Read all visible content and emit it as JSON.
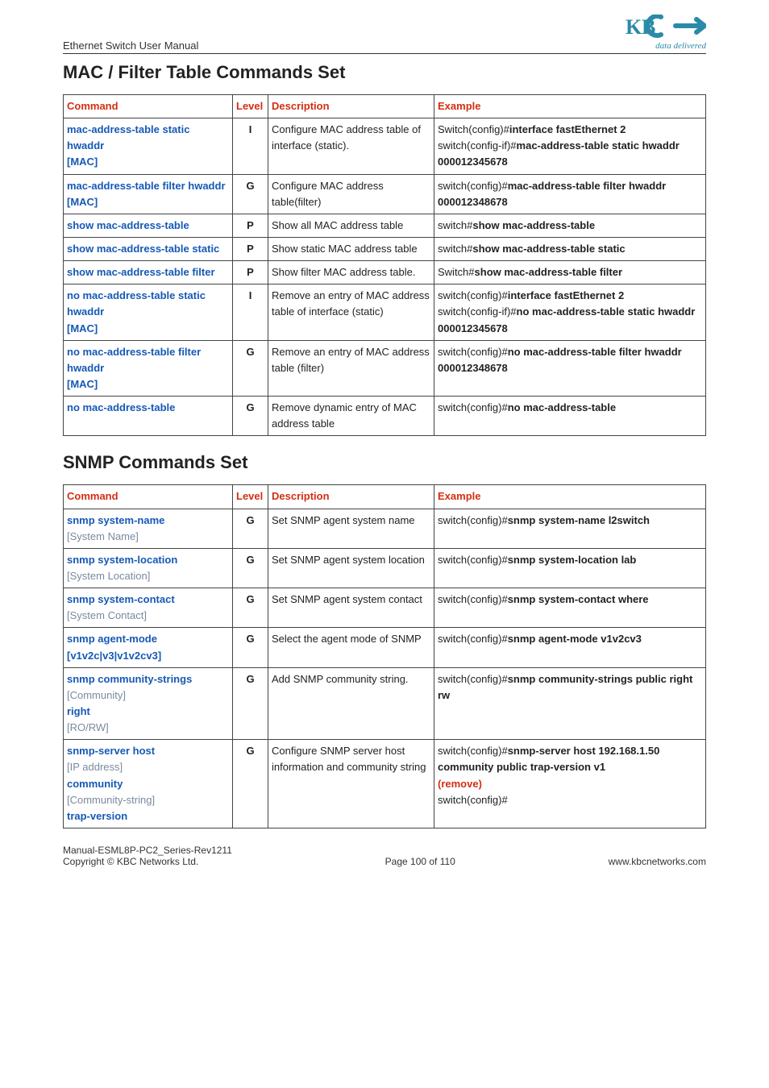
{
  "header": {
    "title": "Ethernet Switch User Manual",
    "logo_tagline": "data delivered"
  },
  "section1": {
    "title": "MAC / Filter Table Commands Set",
    "columns": {
      "cmd": "Command",
      "level": "Level",
      "desc": "Description",
      "example": "Example"
    },
    "rows": [
      {
        "cmd": {
          "kw": "mac-address-table static hwaddr",
          "arg": "[MAC]"
        },
        "level": "I",
        "desc": "Configure MAC address table of interface (static).",
        "ex": [
          {
            "type": "line",
            "pre": "Switch(config)#",
            "bold": "interface fastEthernet 2"
          },
          {
            "type": "line",
            "pre": "switch(config-if)#",
            "bold": "mac-address-table static hwaddr 000012345678"
          }
        ]
      },
      {
        "cmd": {
          "kw": "mac-address-table filter hwaddr",
          "arg": "[MAC]"
        },
        "level": "G",
        "desc": "Configure MAC address table(filter)",
        "ex": [
          {
            "type": "line",
            "pre": "switch(config)#",
            "bold": "mac-address-table filter hwaddr 000012348678"
          }
        ]
      },
      {
        "cmd": {
          "kw": "show mac-address-table"
        },
        "level": "P",
        "desc": "Show all MAC address table",
        "ex": [
          {
            "type": "line",
            "pre": "switch#",
            "bold": "show mac-address-table"
          }
        ]
      },
      {
        "cmd": {
          "kw": "show mac-address-table static"
        },
        "level": "P",
        "desc": "Show static MAC address table",
        "ex": [
          {
            "type": "line",
            "pre": "switch#",
            "bold": "show mac-address-table static"
          }
        ]
      },
      {
        "cmd": {
          "kw": "show mac-address-table filter"
        },
        "level": "P",
        "desc": "Show filter MAC address table.",
        "ex": [
          {
            "type": "line",
            "pre": "Switch#",
            "bold": "show mac-address-table filter"
          }
        ]
      },
      {
        "cmd": {
          "kw": "no mac-address-table static hwaddr",
          "arg": "[MAC]"
        },
        "level": "I",
        "desc": "Remove an entry of MAC address table of interface (static)",
        "ex": [
          {
            "type": "line",
            "pre": "switch(config)#",
            "bold": "interface fastEthernet 2"
          },
          {
            "type": "line",
            "pre": "switch(config-if)#",
            "bold": "no mac-address-table static hwaddr 000012345678"
          }
        ]
      },
      {
        "cmd": {
          "kw": "no mac-address-table filter hwaddr",
          "arg": "[MAC]"
        },
        "level": "G",
        "desc": "Remove an entry of MAC address table (filter)",
        "ex": [
          {
            "type": "line",
            "pre": "switch(config)#",
            "bold": "no mac-address-table filter hwaddr 000012348678"
          }
        ]
      },
      {
        "cmd": {
          "kw": "no mac-address-table"
        },
        "level": "G",
        "desc": "Remove dynamic entry of MAC address table",
        "ex": [
          {
            "type": "line",
            "pre": "switch(config)#",
            "bold": "no mac-address-table"
          }
        ]
      }
    ]
  },
  "section2": {
    "title": "SNMP Commands Set",
    "columns": {
      "cmd": "Command",
      "level": "Level",
      "desc": "Description",
      "example": "Example"
    },
    "rows": [
      {
        "cmd": {
          "kw": "snmp system-name",
          "arg_opt": "[System Name]"
        },
        "level": "G",
        "desc": "Set SNMP agent system name",
        "ex": [
          {
            "type": "line",
            "pre": "switch(config)#",
            "bold": "snmp system-name l2switch"
          }
        ]
      },
      {
        "cmd": {
          "kw": "snmp system-location",
          "arg_opt": "[System Location]"
        },
        "level": "G",
        "desc": "Set SNMP agent system location",
        "ex": [
          {
            "type": "line",
            "pre": "switch(config)#",
            "bold": "snmp system-location lab"
          }
        ]
      },
      {
        "cmd": {
          "kw": "snmp system-contact",
          "arg_opt": "[System Contact]"
        },
        "level": "G",
        "desc": "Set SNMP agent system contact",
        "ex": [
          {
            "type": "line",
            "pre": "switch(config)#",
            "bold": "snmp system-contact where"
          }
        ]
      },
      {
        "cmd": {
          "kw": "snmp agent-mode",
          "arg": "[v1v2c|v3|v1v2cv3]"
        },
        "level": "G",
        "desc": "Select the agent mode of SNMP",
        "ex": [
          {
            "type": "line",
            "pre": "switch(config)#",
            "bold": "snmp agent-mode v1v2cv3"
          }
        ]
      },
      {
        "cmd": {
          "kw": "snmp community-strings",
          "arg_opt": "[Community]",
          "kw2": "right",
          "arg_opt2": "[RO/RW]"
        },
        "level": "G",
        "desc": "Add SNMP community string.",
        "ex": [
          {
            "type": "line",
            "pre": "switch(config)#",
            "bold": "snmp community-strings public right rw"
          }
        ]
      },
      {
        "cmd": {
          "kw": "snmp-server host",
          "arg_opt": "[IP address]",
          "kw2": "community",
          "arg_opt2": "[Community-string]",
          "kw3": "trap-version"
        },
        "level": "G",
        "desc": "Configure SNMP server host information and community string",
        "ex": [
          {
            "type": "line",
            "pre": "switch(config)#",
            "bold": "snmp-server host 192.168.1.50 community public trap-version v1"
          },
          {
            "type": "remove",
            "text": "(remove)"
          },
          {
            "type": "plain",
            "text": "switch(config)#"
          }
        ]
      }
    ]
  },
  "footer": {
    "left_line1": "Manual-ESML8P-PC2_Series-Rev1211",
    "left_line2": "Copyright © KBC Networks Ltd.",
    "center": "Page 100 of 110",
    "right": "www.kbcnetworks.com"
  }
}
